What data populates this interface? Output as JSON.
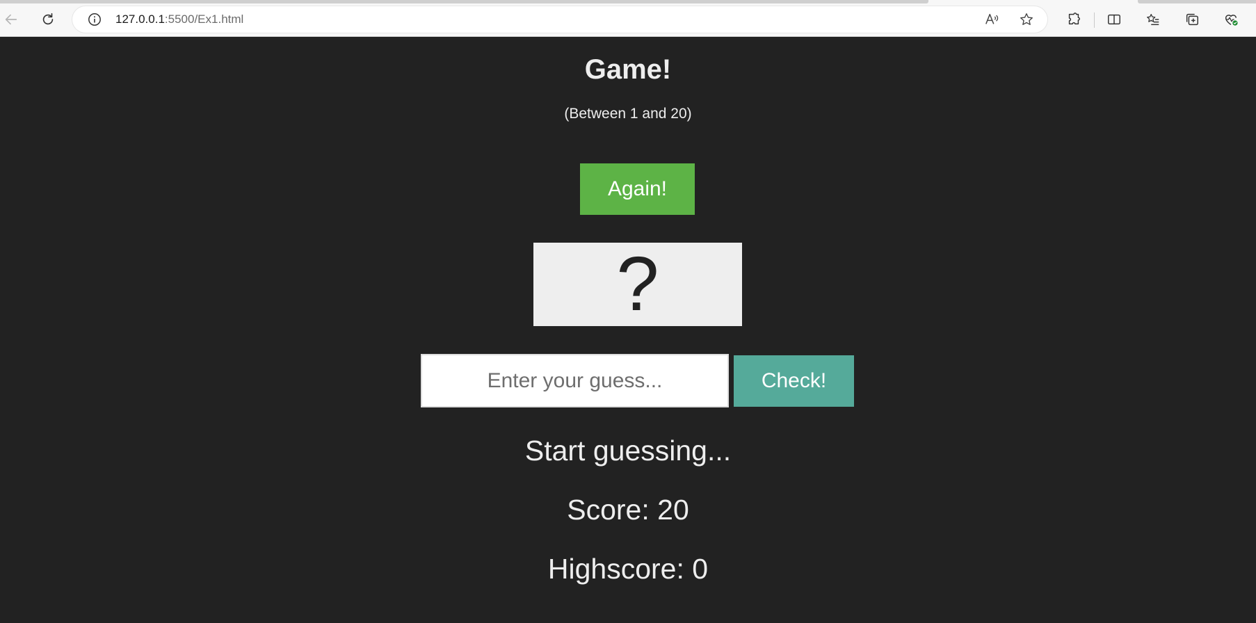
{
  "browser": {
    "url_host": "127.0.0.1",
    "url_path": ":5500/Ex1.html"
  },
  "game": {
    "title": "Game!",
    "range_hint": "(Between 1 and 20)",
    "again_label": "Again!",
    "secret_display": "?",
    "guess_placeholder": "Enter your guess...",
    "guess_value": "",
    "check_label": "Check!",
    "message": "Start guessing...",
    "score_text": "Score: 20",
    "highscore_text": "Highscore: 0"
  },
  "colors": {
    "background": "#222222",
    "again_button": "#5db346",
    "check_button": "#55aa9a",
    "number_box": "#eeeeee"
  }
}
